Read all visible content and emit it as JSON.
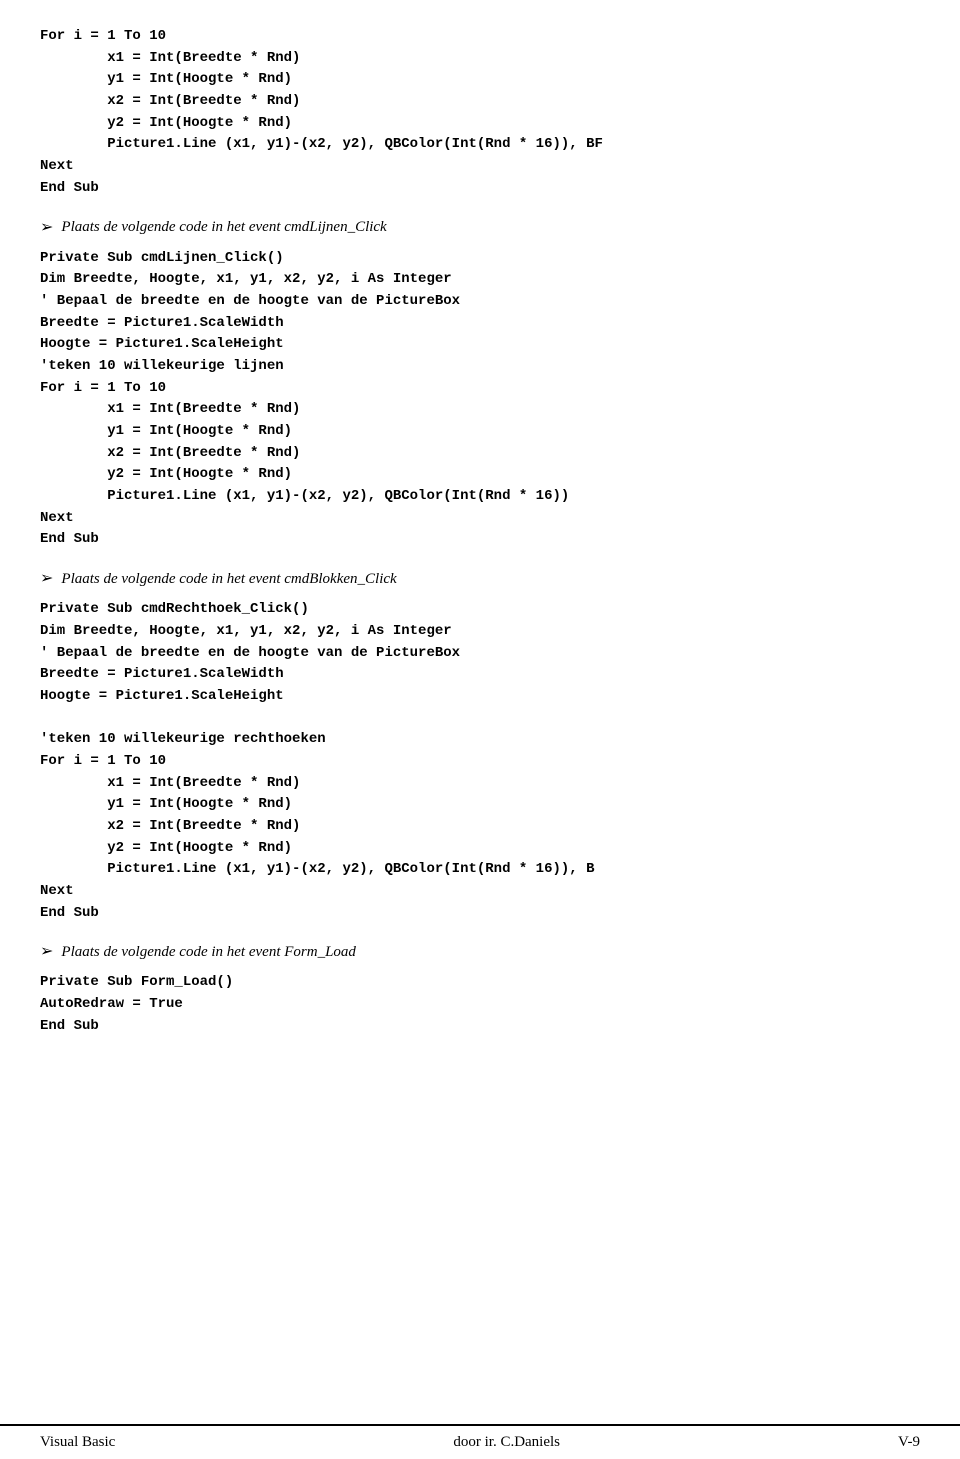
{
  "page": {
    "content_blocks": [
      {
        "type": "code",
        "text": "For i = 1 To 10\n        x1 = Int(Breedte * Rnd)\n        y1 = Int(Hoogte * Rnd)\n        x2 = Int(Breedte * Rnd)\n        y2 = Int(Hoogte * Rnd)\n        Picture1.Line (x1, y1)-(x2, y2), QBColor(Int(Rnd * 16)), BF\nNext\nEnd Sub"
      },
      {
        "type": "instruction",
        "arrow": "➢",
        "text": "Plaats de volgende code in het event cmdLijnen_Click"
      },
      {
        "type": "code",
        "text": "Private Sub cmdLijnen_Click()\nDim Breedte, Hoogte, x1, y1, x2, y2, i As Integer\n' Bepaal de breedte en de hoogte van de PictureBox\nBreedte = Picture1.ScaleWidth\nHoogte = Picture1.ScaleHeight\n'teken 10 willekeurige lijnen\nFor i = 1 To 10\n        x1 = Int(Breedte * Rnd)\n        y1 = Int(Hoogte * Rnd)\n        x2 = Int(Breedte * Rnd)\n        y2 = Int(Hoogte * Rnd)\n        Picture1.Line (x1, y1)-(x2, y2), QBColor(Int(Rnd * 16))\nNext\nEnd Sub"
      },
      {
        "type": "instruction",
        "arrow": "➢",
        "text": "Plaats de volgende code in het event cmdBlokken_Click"
      },
      {
        "type": "code",
        "text": "Private Sub cmdRechthoek_Click()\nDim Breedte, Hoogte, x1, y1, x2, y2, i As Integer\n' Bepaal de breedte en de hoogte van de PictureBox\nBreedte = Picture1.ScaleWidth\nHoogte = Picture1.ScaleHeight\n\n'teken 10 willekeurige rechthoeken\nFor i = 1 To 10\n        x1 = Int(Breedte * Rnd)\n        y1 = Int(Hoogte * Rnd)\n        x2 = Int(Breedte * Rnd)\n        y2 = Int(Hoogte * Rnd)\n        Picture1.Line (x1, y1)-(x2, y2), QBColor(Int(Rnd * 16)), B\nNext\nEnd Sub"
      },
      {
        "type": "instruction",
        "arrow": "➢",
        "text": "Plaats de volgende code in het event Form_Load"
      },
      {
        "type": "code",
        "text": "Private Sub Form_Load()\nAutoRedraw = True\nEnd Sub"
      }
    ],
    "footer": {
      "left": "Visual Basic",
      "center": "door ir. C.Daniels",
      "right": "V-9"
    }
  }
}
